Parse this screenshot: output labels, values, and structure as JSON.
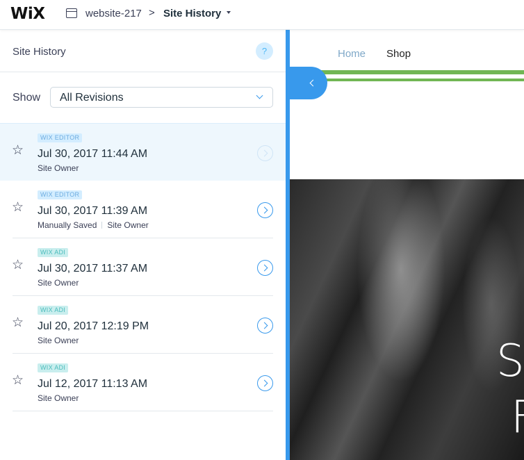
{
  "topbar": {
    "logo": "WiX",
    "site_name": "website-217",
    "separator": ">",
    "current_page": "Site History"
  },
  "panel": {
    "title": "Site History",
    "help": "?",
    "show_label": "Show",
    "filter": {
      "selected": "All Revisions"
    },
    "revisions": [
      {
        "badge": "WIX EDITOR",
        "badge_type": "editor",
        "date": "Jul 30, 2017 11:44 AM",
        "meta": [
          "Site Owner"
        ],
        "selected": true
      },
      {
        "badge": "WIX EDITOR",
        "badge_type": "editor",
        "date": "Jul 30, 2017 11:39 AM",
        "meta": [
          "Manually Saved",
          "Site Owner"
        ],
        "selected": false
      },
      {
        "badge": "WIX ADI",
        "badge_type": "adi",
        "date": "Jul 30, 2017 11:37 AM",
        "meta": [
          "Site Owner"
        ],
        "selected": false
      },
      {
        "badge": "WIX ADI",
        "badge_type": "adi",
        "date": "Jul 20, 2017 12:19 PM",
        "meta": [
          "Site Owner"
        ],
        "selected": false
      },
      {
        "badge": "WIX ADI",
        "badge_type": "adi",
        "date": "Jul 12, 2017 11:13 AM",
        "meta": [
          "Site Owner"
        ],
        "selected": false
      }
    ]
  },
  "preview": {
    "nav": [
      "Home",
      "Shop"
    ],
    "hero_letters": [
      "S",
      "F"
    ]
  },
  "colors": {
    "accent": "#3899ec",
    "green_bar": "#71b654",
    "editor_badge_bg": "#d3edff",
    "adi_badge_bg": "#c9eeee"
  }
}
